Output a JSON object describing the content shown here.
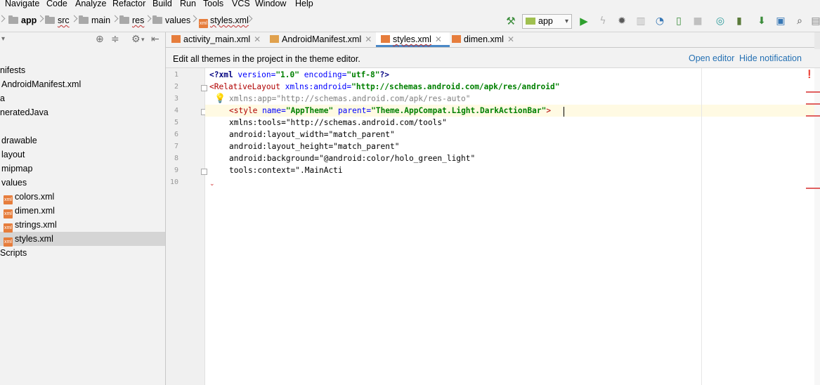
{
  "menu": [
    "Navigate",
    "Code",
    "Analyze",
    "Refactor",
    "Build",
    "Run",
    "Tools",
    "VCS",
    "Window",
    "Help"
  ],
  "breadcrumbs": [
    "app",
    "src",
    "main",
    "res",
    "values",
    "styles.xml"
  ],
  "toolbar": {
    "run_config": "app"
  },
  "project_tree": [
    "nifests",
    "AndroidManifest.xml",
    "a",
    "neratedJava",
    "drawable",
    "layout",
    "mipmap",
    "values",
    "colors.xml",
    "dimen.xml",
    "strings.xml",
    "styles.xml",
    "Scripts"
  ],
  "tabs": [
    {
      "label": "activity_main.xml",
      "active": false
    },
    {
      "label": "AndroidManifest.xml",
      "active": false
    },
    {
      "label": "styles.xml",
      "active": true
    },
    {
      "label": "dimen.xml",
      "active": false
    }
  ],
  "notification": {
    "message": "Edit all themes in the project in the theme editor.",
    "open_editor": "Open editor",
    "hide": "Hide notification"
  },
  "line_numbers": [
    "1",
    "2",
    "3",
    "4",
    "5",
    "6",
    "7",
    "8",
    "9",
    "10"
  ],
  "code": {
    "l1_a": "<?xml ",
    "l1_b": "version=",
    "l1_c": "\"1.0\"",
    "l1_d": " encoding=",
    "l1_e": "\"utf-8\"",
    "l1_f": "?>",
    "l2_a": "<RelativeLayout ",
    "l2_b": "xmlns:android=",
    "l2_c": "\"http://schemas.android.com/apk/res/android\"",
    "l3": "xmlns:app=\"http://schemas.android.com/apk/res-auto\"",
    "l4_a": "<style ",
    "l4_b": "name=",
    "l4_c": "\"AppTheme\"",
    "l4_d": " parent=",
    "l4_e": "\"Theme.AppCompat.Light.DarkActionBar\"",
    "l4_f": ">",
    "l5": "xmlns:tools=\"http://schemas.android.com/tools\"",
    "l6": "android:layout_width=\"match_parent\"",
    "l7": "android:layout_height=\"match_parent\"",
    "l8": "android:background=\"@android:color/holo_green_light\"",
    "l9": "tools:context=\".MainActi"
  },
  "colors": {
    "accent": "#4a88c7",
    "link": "#2470b3",
    "error": "#e06060"
  }
}
